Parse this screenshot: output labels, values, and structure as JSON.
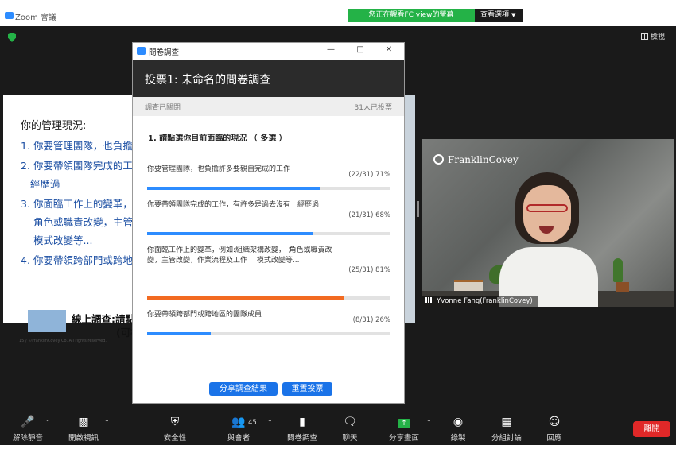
{
  "app": {
    "title": "Zoom 會議"
  },
  "banner": {
    "viewing": "您正在觀看FC view的螢幕",
    "view_options": "查看選項"
  },
  "stage": {
    "view_label": "檢視"
  },
  "slide": {
    "heading": "你的管理現況:",
    "items": [
      "1. 你要管理團隊，也負擔",
      "2. 你要帶領團隊完成的工",
      "經歷過",
      "3. 你面臨工作上的變革，",
      "角色或職責改變，主管",
      "模式改變等...",
      "4. 你要帶領跨部門或跨地"
    ],
    "footer_line1": "線上調查:請點",
    "footer_line2": "(可複",
    "page_note": "15 / ©FranklinCovey Co. All rights reserved."
  },
  "video": {
    "logo": "FranklinCovey",
    "name": "Yvonne Fang(FranklinCovey)"
  },
  "poll": {
    "window_title": "問卷調查",
    "header": "投票1: 未命名的問卷調查",
    "status": "調查已關閉",
    "voters": "31人已投票",
    "question": "1. 請點選你目前面臨的現況 （ 多選 ）",
    "options": [
      {
        "text": "你要管理團隊，也負擔許多要親自完成的工作",
        "stat": "(22/31) 71%",
        "percent": 71,
        "color": "#2d8cff"
      },
      {
        "text": "你要帶領團隊完成的工作，有許多是過去沒有　經歷過",
        "stat": "(21/31) 68%",
        "percent": 68,
        "color": "#2d8cff"
      },
      {
        "text": "你面臨工作上的變革，例如:組織架構改變，　角色或職責改變，主管改變，作業流程及工作　 模式改變等...",
        "stat": "(25/31) 81%",
        "percent": 81,
        "color": "#f26a21"
      },
      {
        "text": "你要帶領跨部門或跨地區的團隊成員",
        "stat": "(8/31) 26%",
        "percent": 26,
        "color": "#2d8cff"
      }
    ],
    "share_button": "分享調查結果",
    "relaunch_button": "重置投票"
  },
  "toolbar": {
    "mute": "解除靜音",
    "video": "開啟視訊",
    "security": "安全性",
    "participants": "與會者",
    "participants_count": "45",
    "polls": "問卷調查",
    "chat": "聊天",
    "share": "分享畫面",
    "record": "錄製",
    "breakout": "分組討論",
    "reactions": "回應",
    "leave": "離開"
  }
}
